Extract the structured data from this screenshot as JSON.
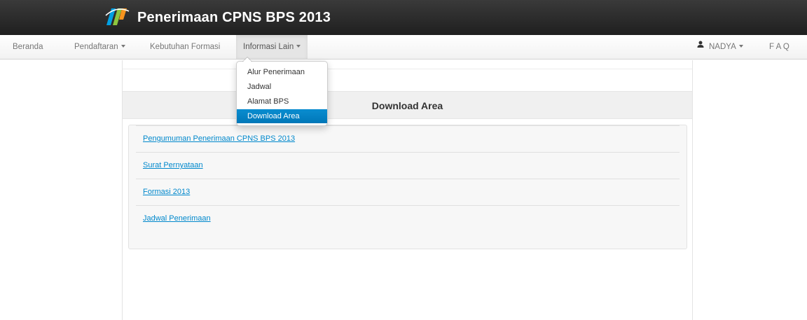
{
  "app": {
    "title": "Penerimaan CPNS BPS 2013",
    "logo_icon": "bps-logo-icon",
    "brand_colors": [
      "#f7941d",
      "#8dc63f",
      "#00a0e3"
    ]
  },
  "navbar": {
    "items": [
      {
        "label": "Beranda",
        "has_caret": false
      },
      {
        "label": "Pendaftaran",
        "has_caret": true
      },
      {
        "label": "Kebutuhan Formasi",
        "has_caret": false
      },
      {
        "label": "Informasi Lain",
        "has_caret": true,
        "active": true
      }
    ],
    "right_items": [
      {
        "label": "NADYA",
        "icon": "user-icon",
        "has_caret": true
      },
      {
        "label": "F A Q",
        "has_caret": false
      }
    ]
  },
  "dropdown": {
    "items": [
      {
        "label": "Alur Penerimaan"
      },
      {
        "label": "Jadwal"
      },
      {
        "label": "Alamat BPS"
      },
      {
        "label": "Download Area",
        "active": true
      }
    ]
  },
  "main": {
    "section_title": "Download Area",
    "downloads": [
      {
        "label": "Pengumuman Penerimaan CPNS BPS 2013"
      },
      {
        "label": "Surat Pernyataan"
      },
      {
        "label": "Formasi 2013"
      },
      {
        "label": "Jadwal Penerimaan"
      }
    ]
  },
  "colors": {
    "topbar": "#2a2a2a",
    "link": "#0088cc",
    "dropdown_active": "#0081c2"
  }
}
